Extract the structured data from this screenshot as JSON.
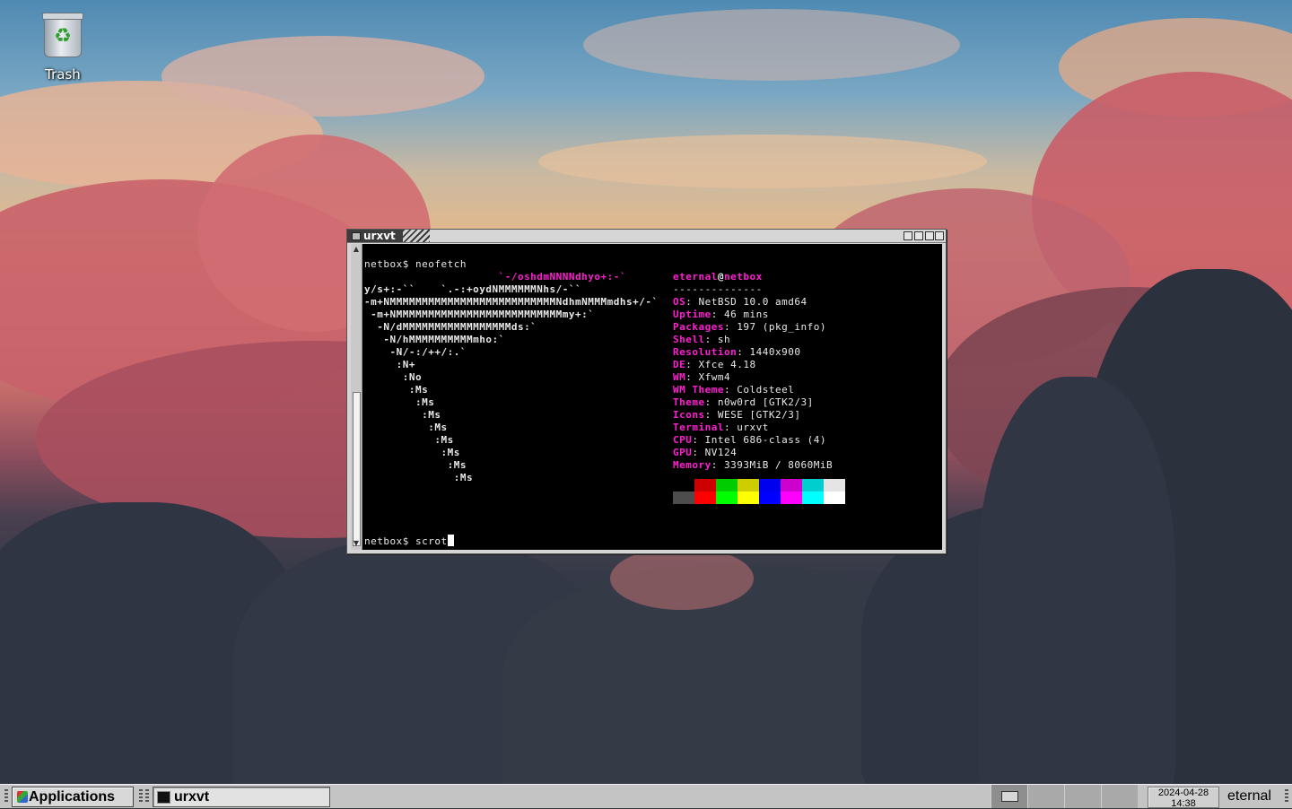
{
  "desktop": {
    "trash_label": "Trash"
  },
  "window": {
    "title": "urxvt"
  },
  "terminal": {
    "prompt1": "netbox$ neofetch",
    "logo_lines": [
      "                     `-/oshdmNNNNdhyo+:-`",
      "y/s+:-``    `.-:+oydNMMMMMMNhs/-``",
      "-m+NMMMMMMMMMMMMMMMMMMMMMMMMMMNdhmNMMMmdhs+/-`",
      " -m+NMMMMMMMMMMMMMMMMMMMMMMMMMMmy+:`",
      "  -N/dMMMMMMMMMMMMMMMMMds:`",
      "   -N/hMMMMMMMMMMmho:`",
      "    -N/-:/++/:.`",
      "     :N+",
      "      :No",
      "       :Ms",
      "        :Ms",
      "         :Ms",
      "          :Ms",
      "           :Ms",
      "            :Ms",
      "             :Ms",
      "              :Ms"
    ],
    "user": "eternal",
    "at": "@",
    "host": "netbox",
    "separator": "--------------",
    "info": [
      {
        "key": "OS",
        "value": ": NetBSD 10.0 amd64"
      },
      {
        "key": "Uptime",
        "value": ": 46 mins"
      },
      {
        "key": "Packages",
        "value": ": 197 (pkg_info)"
      },
      {
        "key": "Shell",
        "value": ": sh"
      },
      {
        "key": "Resolution",
        "value": ": 1440x900"
      },
      {
        "key": "DE",
        "value": ": Xfce 4.18"
      },
      {
        "key": "WM",
        "value": ": Xfwm4"
      },
      {
        "key": "WM Theme",
        "value": ": Coldsteel"
      },
      {
        "key": "Theme",
        "value": ": n0w0rd [GTK2/3]"
      },
      {
        "key": "Icons",
        "value": ": WESE [GTK2/3]"
      },
      {
        "key": "Terminal",
        "value": ": urxvt"
      },
      {
        "key": "CPU",
        "value": ": Intel 686-class (4)"
      },
      {
        "key": "GPU",
        "value": ": NV124"
      },
      {
        "key": "Memory",
        "value": ": 3393MiB / 8060MiB"
      }
    ],
    "palette_top": [
      "#000000",
      "#ff0000",
      "#00ff00",
      "#ffff00",
      "#0000ff",
      "#ff00ff",
      "#00ffff",
      "#ffffff"
    ],
    "palette_normal": [
      "#000000",
      "#cd0000",
      "#00cd00",
      "#cdcd00",
      "#0000ee",
      "#cd00cd",
      "#00cdcd",
      "#e5e5e5"
    ],
    "palette_bright": [
      "#4d4d4d",
      "#ff0000",
      "#00ff00",
      "#ffff00",
      "#0000ff",
      "#ff00ff",
      "#00ffff",
      "#ffffff"
    ],
    "prompt2": "netbox$ scrot"
  },
  "taskbar": {
    "applications_label": "Applications",
    "task_label": "urxvt",
    "date": "2024-04-28",
    "time": "14:38",
    "username": "eternal"
  },
  "colors": {
    "accent_pink": "#ff1fd1",
    "terminal_bg": "#000000",
    "panel_bg": "#c4c4c4"
  }
}
